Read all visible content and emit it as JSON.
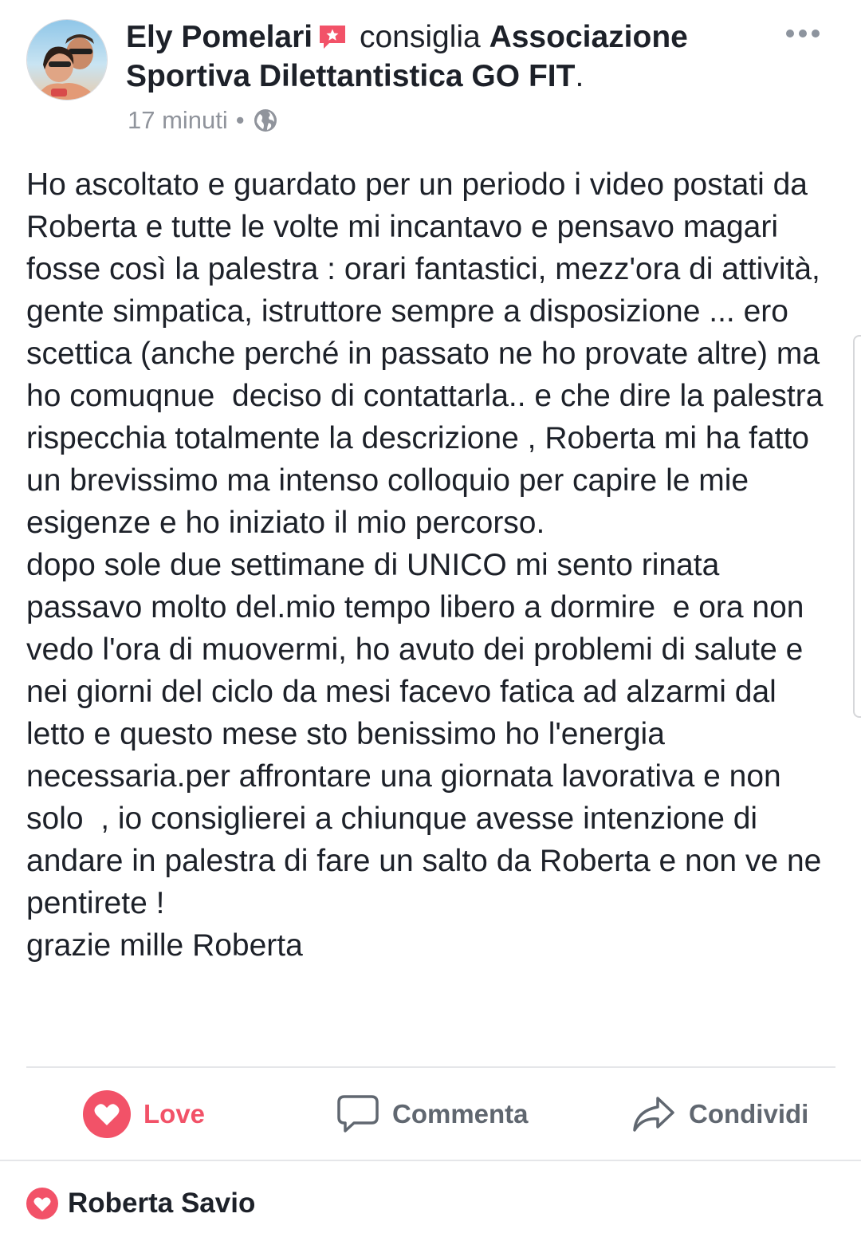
{
  "post": {
    "author": "Ely Pomelari",
    "verb": "consiglia",
    "page_name": "Associazione Sportiva Dilettantistica GO FIT",
    "period": ".",
    "timestamp": "17 minuti",
    "separator": "•",
    "privacy_icon": "globe-icon",
    "body_paragraphs": [
      "Ho ascoltato e guardato per un periodo i video postati da Roberta e tutte le volte mi incantavo e pensavo magari fosse così la palestra : orari fantastici, mezz'ora di attività,  gente simpatica, istruttore sempre a disposizione ... ero scettica (anche perché in passato ne ho provate altre) ma ho comuqnue  deciso di contattarla.. e che dire la palestra rispecchia totalmente la descrizione , Roberta mi ha fatto un brevissimo ma intenso colloquio per capire le mie esigenze e ho iniziato il mio percorso.",
      "dopo sole due settimane di UNICO mi sento rinata passavo molto del.mio tempo libero a dormire  e ora non vedo l'ora di muovermi, ho avuto dei problemi di salute e nei giorni del ciclo da mesi facevo fatica ad alzarmi dal letto e questo mese sto benissimo ho l'energia necessaria.per affrontare una giornata lavorativa e non solo  , io consiglierei a chiunque avesse intenzione di andare in palestra di fare un salto da Roberta e non ve ne pentirete !",
      "grazie mille Roberta"
    ]
  },
  "actions": {
    "love_label": "Love",
    "comment_label": "Commenta",
    "share_label": "Condividi"
  },
  "reactions": {
    "names": "Roberta Savio"
  },
  "colors": {
    "love": "#f25268",
    "text": "#1d2129",
    "muted": "#90949c",
    "action_gray": "#606770"
  }
}
